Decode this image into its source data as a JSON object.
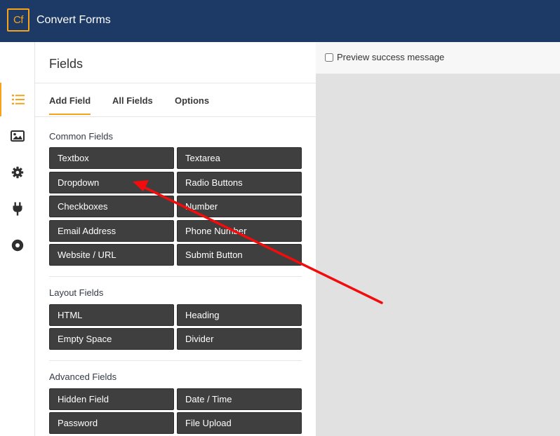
{
  "app": {
    "logo_text": "Cf",
    "title": "Convert Forms",
    "brand_color": "#1d3a67",
    "accent_color": "#f6a31b"
  },
  "iconbar": {
    "items": [
      {
        "icon": "list-icon",
        "active": true
      },
      {
        "icon": "image-icon",
        "active": false
      },
      {
        "icon": "gear-icon",
        "active": false
      },
      {
        "icon": "plug-icon",
        "active": false
      },
      {
        "icon": "record-icon",
        "active": false
      }
    ]
  },
  "panel": {
    "title": "Fields",
    "tabs": [
      {
        "label": "Add Field",
        "active": true
      },
      {
        "label": "All Fields",
        "active": false
      },
      {
        "label": "Options",
        "active": false
      }
    ],
    "sections": {
      "common": {
        "title": "Common Fields",
        "buttons": [
          "Textbox",
          "Textarea",
          "Dropdown",
          "Radio Buttons",
          "Checkboxes",
          "Number",
          "Email Address",
          "Phone Number",
          "Website / URL",
          "Submit Button"
        ]
      },
      "layout": {
        "title": "Layout Fields",
        "buttons": [
          "HTML",
          "Heading",
          "Empty Space",
          "Divider"
        ]
      },
      "advanced": {
        "title": "Advanced Fields",
        "buttons": [
          "Hidden Field",
          "Date / Time",
          "Password",
          "File Upload"
        ]
      }
    }
  },
  "preview": {
    "checkbox_label": "Preview success message",
    "checked": false
  },
  "annotation": {
    "arrow_color": "#f20c0c"
  }
}
